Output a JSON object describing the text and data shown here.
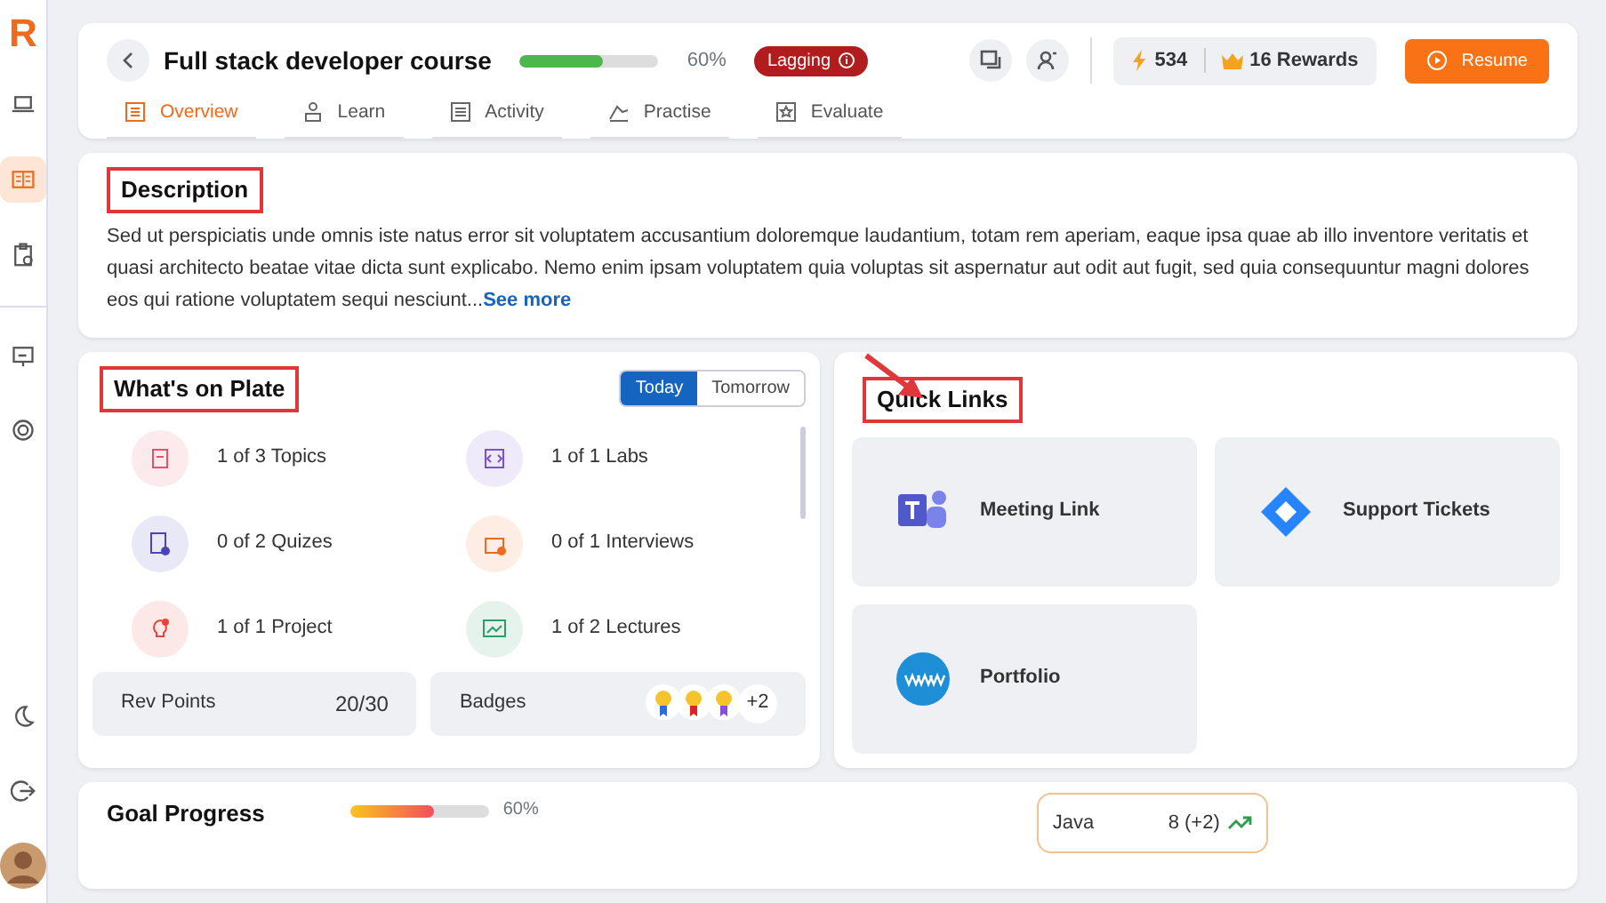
{
  "sidebar": {
    "logo": "R",
    "nav_items": [
      {
        "kind": "laptop",
        "selected": false
      },
      {
        "kind": "book",
        "selected": true
      },
      {
        "kind": "clipboard",
        "selected": false
      },
      {
        "kind": "presentation",
        "selected": false
      },
      {
        "kind": "badge",
        "selected": false
      }
    ]
  },
  "header": {
    "title": "Full stack developer course",
    "progress": {
      "level": 0.6,
      "reading": "60%"
    },
    "status": "Lagging",
    "tabs": [
      {
        "kind": "overview",
        "label": "Overview",
        "selected": true
      },
      {
        "kind": "learn",
        "label": "Learn",
        "selected": false
      },
      {
        "kind": "activity",
        "label": "Activity",
        "selected": false
      },
      {
        "kind": "practise",
        "label": "Practise",
        "selected": false
      },
      {
        "kind": "evaluate",
        "label": "Evaluate",
        "selected": false
      }
    ],
    "points": "534",
    "rewards": "16 Rewards",
    "resume": "Resume"
  },
  "description": {
    "title": "Description",
    "highlighted": true,
    "text": "Sed ut perspiciatis unde omnis iste natus error sit voluptatem accusantium doloremque laudantium, totam rem aperiam, eaque ipsa quae ab illo inventore veritatis et quasi architecto beatae vitae dicta sunt explicabo. Nemo enim ipsam voluptatem quia voluptas sit aspernatur aut odit aut fugit, sed quia consequuntur magni dolores eos qui ratione voluptatem sequi nesciunt...",
    "link": "See more"
  },
  "plate": {
    "title": "What's on Plate",
    "highlighted": true,
    "toggle": [
      {
        "label": "Today",
        "selected": true
      },
      {
        "label": "Tomorrow",
        "selected": false
      }
    ],
    "items": [
      {
        "kind": "topics",
        "label": "1 of 3 Topics",
        "color": "#e8506a"
      },
      {
        "kind": "labs",
        "label": "1 of 1 Labs",
        "color": "#7b4fd6"
      },
      {
        "kind": "quizzes",
        "label": "0 of 2 Quizes",
        "color": "#4b45b8"
      },
      {
        "kind": "interviews",
        "label": "0 of 1 Interviews",
        "color": "#f06a1d"
      },
      {
        "kind": "project",
        "label": "1 of 1 Project",
        "color": "#e8423a"
      },
      {
        "kind": "lectures",
        "label": "1 of 2 Lectures",
        "color": "#2e9d6a"
      }
    ],
    "rev_points": {
      "label": "Rev Points",
      "value": "20/30"
    },
    "badges": {
      "label": "Badges",
      "more": "+2"
    }
  },
  "quick_links": {
    "title": "Quick Links",
    "highlighted": true,
    "arrow": true,
    "links": [
      {
        "kind": "meeting",
        "label": "Meeting Link"
      },
      {
        "kind": "tickets",
        "label": "Support Tickets"
      },
      {
        "kind": "web",
        "label": "Portfolio"
      }
    ]
  },
  "goal": {
    "title": "Goal Progress",
    "level": 0.6,
    "reading": "60%",
    "skills": [
      {
        "name": "Java",
        "value": "8 (+2)"
      }
    ]
  }
}
